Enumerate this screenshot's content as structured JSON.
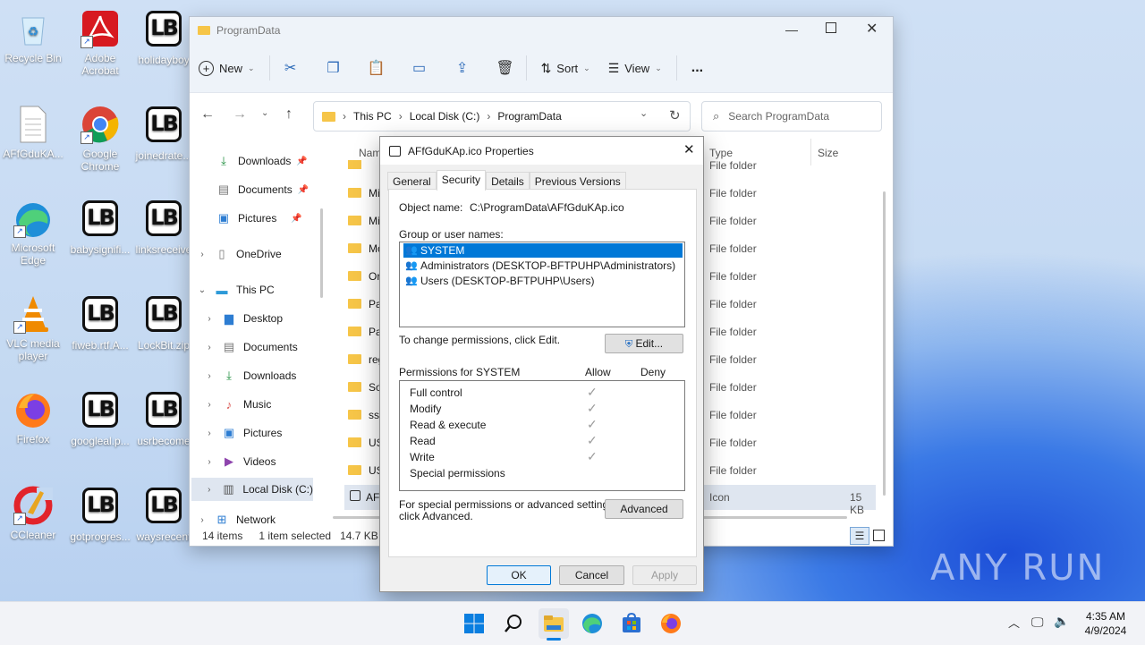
{
  "desktop": {
    "icons": [
      {
        "label": "Recycle Bin"
      },
      {
        "label": "Adobe Acrobat"
      },
      {
        "label": "holidayboy"
      },
      {
        "label": "AFfGduKA..."
      },
      {
        "label": "Google Chrome"
      },
      {
        "label": "joinedrate..."
      },
      {
        "label": "Microsoft Edge"
      },
      {
        "label": "babysignifi..."
      },
      {
        "label": "linksreceive"
      },
      {
        "label": "VLC media player"
      },
      {
        "label": "fiweb.rtf.A..."
      },
      {
        "label": "LockBit.zip"
      },
      {
        "label": "Firefox"
      },
      {
        "label": "googleal.p..."
      },
      {
        "label": "usrbecome"
      },
      {
        "label": "CCleaner"
      },
      {
        "label": "gotprogres..."
      },
      {
        "label": "waysrecent"
      }
    ],
    "lockbit_glyph": "LB",
    "watermark": "ANY RUN"
  },
  "explorer": {
    "title": "ProgramData",
    "toolbar": {
      "new": "New",
      "sort": "Sort",
      "view": "View",
      "more": "..."
    },
    "address": {
      "segments": [
        "This PC",
        "Local Disk (C:)",
        "ProgramData"
      ]
    },
    "search_placeholder": "Search ProgramData",
    "nav": {
      "downloads_pinned": "Downloads",
      "documents_pinned": "Documents",
      "pictures_pinned": "Pictures",
      "onedrive": "OneDrive",
      "thispc": "This PC",
      "desktop": "Desktop",
      "documents": "Documents",
      "downloads": "Downloads",
      "music": "Music",
      "pictures": "Pictures",
      "videos": "Videos",
      "localdisk": "Local Disk (C:)",
      "network": "Network"
    },
    "columns": {
      "name": "Nam",
      "type": "Type",
      "size": "Size"
    },
    "rows": [
      {
        "name": "Mi",
        "type": "File folder",
        "size": ""
      },
      {
        "name": "Mi",
        "type": "File folder",
        "size": ""
      },
      {
        "name": "Mo",
        "type": "File folder",
        "size": ""
      },
      {
        "name": "Ora",
        "type": "File folder",
        "size": ""
      },
      {
        "name": "Pac",
        "type": "File folder",
        "size": ""
      },
      {
        "name": "Pac",
        "type": "File folder",
        "size": ""
      },
      {
        "name": "reg",
        "type": "File folder",
        "size": ""
      },
      {
        "name": "Sof",
        "type": "File folder",
        "size": ""
      },
      {
        "name": "ssh",
        "type": "File folder",
        "size": ""
      },
      {
        "name": "US",
        "type": "File folder",
        "size": ""
      },
      {
        "name": "US",
        "type": "File folder",
        "size": ""
      },
      {
        "name": "Wi",
        "type": "File folder",
        "size": ""
      },
      {
        "name": "AF",
        "type": "Icon",
        "size": "15 KB"
      }
    ],
    "partial_type": "File folder",
    "status": {
      "items": "14 items",
      "selected": "1 item selected",
      "size": "14.7 KB"
    }
  },
  "dialog": {
    "title": "AFfGduKAp.ico Properties",
    "tabs": [
      "General",
      "Security",
      "Details",
      "Previous Versions"
    ],
    "object_label": "Object name:",
    "object_value": "C:\\ProgramData\\AFfGduKAp.ico",
    "group_label": "Group or user names:",
    "users": [
      "SYSTEM",
      "Administrators (DESKTOP-BFTPUHP\\Administrators)",
      "Users (DESKTOP-BFTPUHP\\Users)"
    ],
    "change_text": "To change permissions, click Edit.",
    "edit_button": "Edit...",
    "perm_label": "Permissions for SYSTEM",
    "allow": "Allow",
    "deny": "Deny",
    "permissions": [
      "Full control",
      "Modify",
      "Read & execute",
      "Read",
      "Write",
      "Special permissions"
    ],
    "advanced_text_1": "For special permissions or advanced settings,",
    "advanced_text_2": "click Advanced.",
    "advanced_button": "Advanced",
    "ok": "OK",
    "cancel": "Cancel",
    "apply": "Apply"
  },
  "taskbar": {
    "time": "4:35 AM",
    "date": "4/9/2024"
  }
}
